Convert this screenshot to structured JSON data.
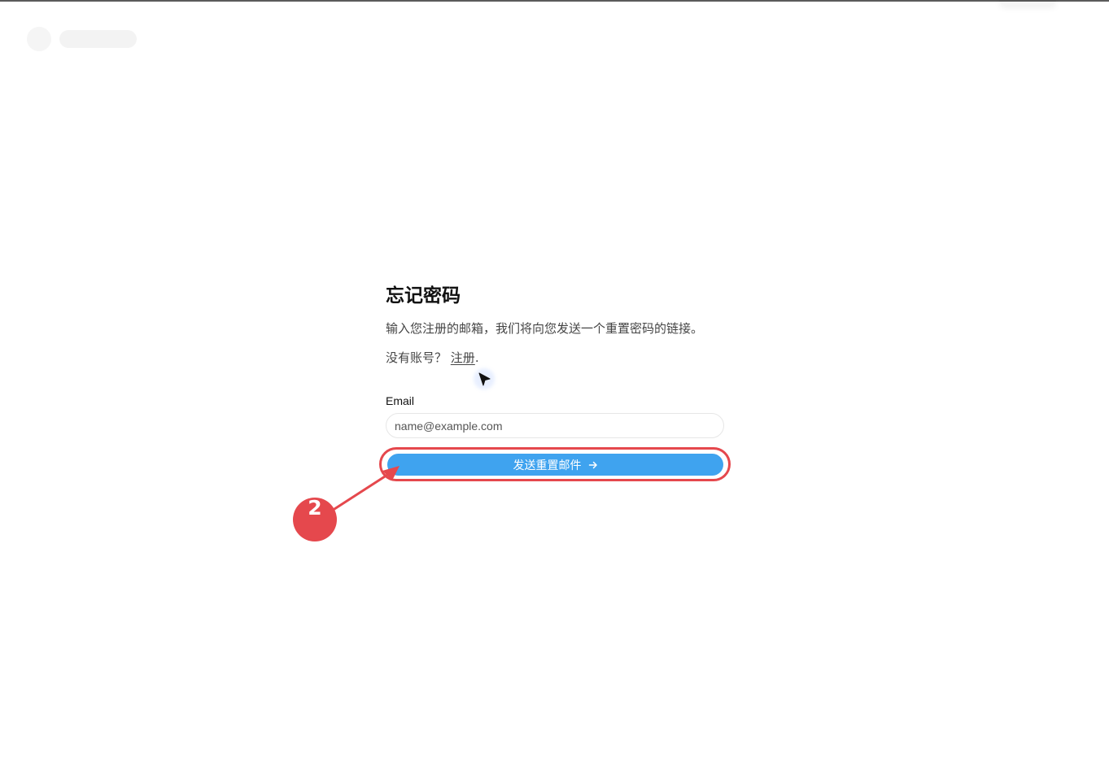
{
  "form": {
    "title": "忘记密码",
    "subtitle": "输入您注册的邮箱，我们将向您发送一个重置密码的链接。",
    "signup_prompt": "没有账号？",
    "signup_link": "注册",
    "signup_suffix": ".",
    "email_label": "Email",
    "email_placeholder": "name@example.com",
    "submit_label": "发送重置邮件"
  },
  "annotation": {
    "step": "2"
  },
  "colors": {
    "accent": "#3fa3ef",
    "annotation": "#e5484d"
  },
  "icons": {
    "submit": "arrow-right-icon",
    "cursor": "cursor-icon"
  }
}
